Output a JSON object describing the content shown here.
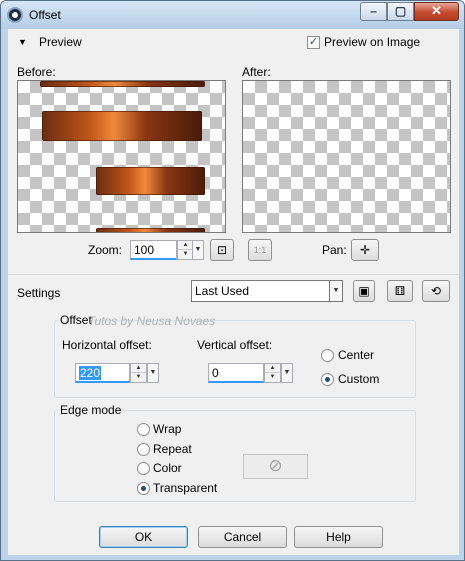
{
  "window": {
    "title": "Offset"
  },
  "preview": {
    "section_label": "Preview",
    "preview_on_image_label": "Preview on Image",
    "preview_on_image_checked": true,
    "before_label": "Before:",
    "after_label": "After:",
    "zoom_label": "Zoom:",
    "zoom_value": "100",
    "pan_label": "Pan:",
    "one_to_one_label": "1:1"
  },
  "settings": {
    "label": "Settings",
    "preset_value": "Last Used"
  },
  "offset": {
    "group_label": "Offset",
    "watermark": "Tutos by Neusa Novaes",
    "horizontal_label": "Horizontal offset:",
    "horizontal_value": "220",
    "vertical_label": "Vertical offset:",
    "vertical_value": "0",
    "mode_options": [
      "Center",
      "Custom"
    ],
    "mode_selected": "Custom"
  },
  "edge_mode": {
    "group_label": "Edge mode",
    "options": [
      "Wrap",
      "Repeat",
      "Color",
      "Transparent"
    ],
    "selected": "Transparent"
  },
  "buttons": {
    "ok": "OK",
    "cancel": "Cancel",
    "help": "Help"
  },
  "colors": {
    "titlebar": "#bcd3ea",
    "dialog_bg": "#f0f0f0",
    "close_button": "#c44b2e",
    "selection": "#3399ff"
  },
  "icons": {
    "collapse": "triangle-down-icon",
    "zoom_fit": "zoom-to-fit-icon",
    "pan": "pan-move-icon",
    "save_preset": "save-icon",
    "randomize": "dice-icon",
    "reset": "reset-icon",
    "color_disabled": "no-color-icon"
  }
}
